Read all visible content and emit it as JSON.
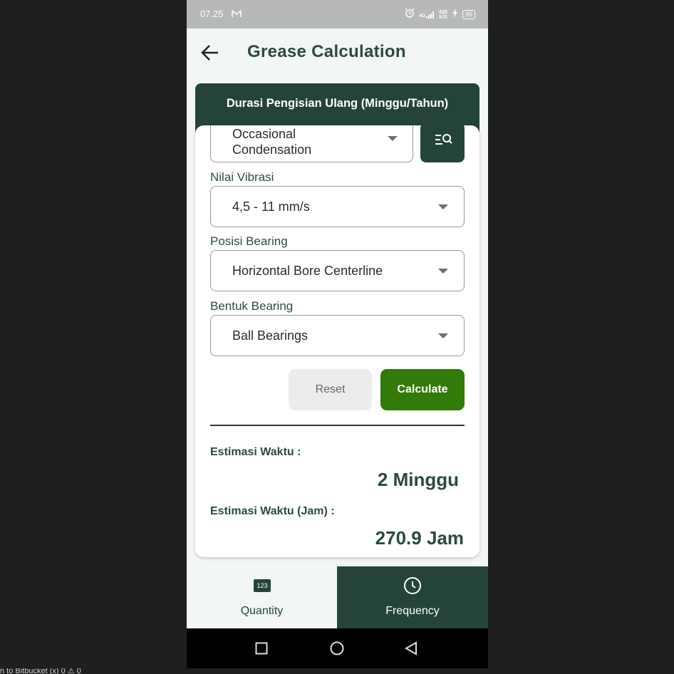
{
  "desktop": {
    "footer_text": "n to Bitbucket    (x) 0  ⚠ 0"
  },
  "status_bar": {
    "time": "07.25",
    "network_label": "4G",
    "speed_value": "625",
    "speed_unit": "K/S",
    "battery": "95"
  },
  "header": {
    "title": "Grease Calculation",
    "back_icon": "arrow-left-icon"
  },
  "card": {
    "title": "Durasi Pengisian Ulang (Minggu/Tahun)",
    "first_dropdown": {
      "value_line1": "Occasional",
      "value_line2": "Condensation"
    },
    "search_button_icon": "list-search-icon",
    "fields": [
      {
        "label": "Nilai Vibrasi",
        "value": "4,5 - 11 mm/s"
      },
      {
        "label": "Posisi Bearing",
        "value": "Horizontal Bore Centerline"
      },
      {
        "label": "Bentuk Bearing",
        "value": "Ball Bearings"
      }
    ],
    "buttons": {
      "reset": "Reset",
      "calculate": "Calculate"
    },
    "results": {
      "label_weeks": "Estimasi Waktu :",
      "value_weeks": "2 Minggu",
      "label_hours": "Estimasi Waktu (Jam) :",
      "value_hours": "270.9 Jam"
    }
  },
  "bottom_nav": {
    "items": [
      {
        "label": "Quantity",
        "icon": "number-123-icon",
        "icon_text": "123",
        "active": false
      },
      {
        "label": "Frequency",
        "icon": "clock-icon",
        "active": true
      }
    ]
  },
  "colors": {
    "primary_dark": "#24443a",
    "accent_green": "#327a09",
    "title_text": "#2a4a3f",
    "background": "#f3f6f6"
  }
}
